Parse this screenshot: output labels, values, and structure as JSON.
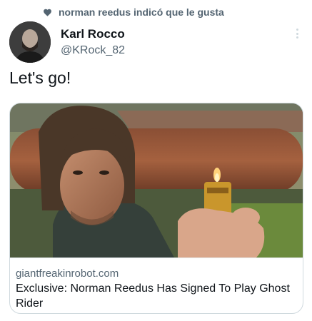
{
  "social_context": {
    "text": "norman reedus indicó que le gusta",
    "icon": "heart-icon"
  },
  "author": {
    "name": "Karl Rocco",
    "handle": "@KRock_82"
  },
  "tweet": {
    "text": "Let's go!"
  },
  "card": {
    "domain": "giantfreakinrobot.com",
    "title": "Exclusive: Norman Reedus Has Signed To Play Ghost Rider"
  },
  "colors": {
    "primary_text": "#0f1419",
    "secondary_text": "#536471",
    "border": "#cfd9de"
  }
}
